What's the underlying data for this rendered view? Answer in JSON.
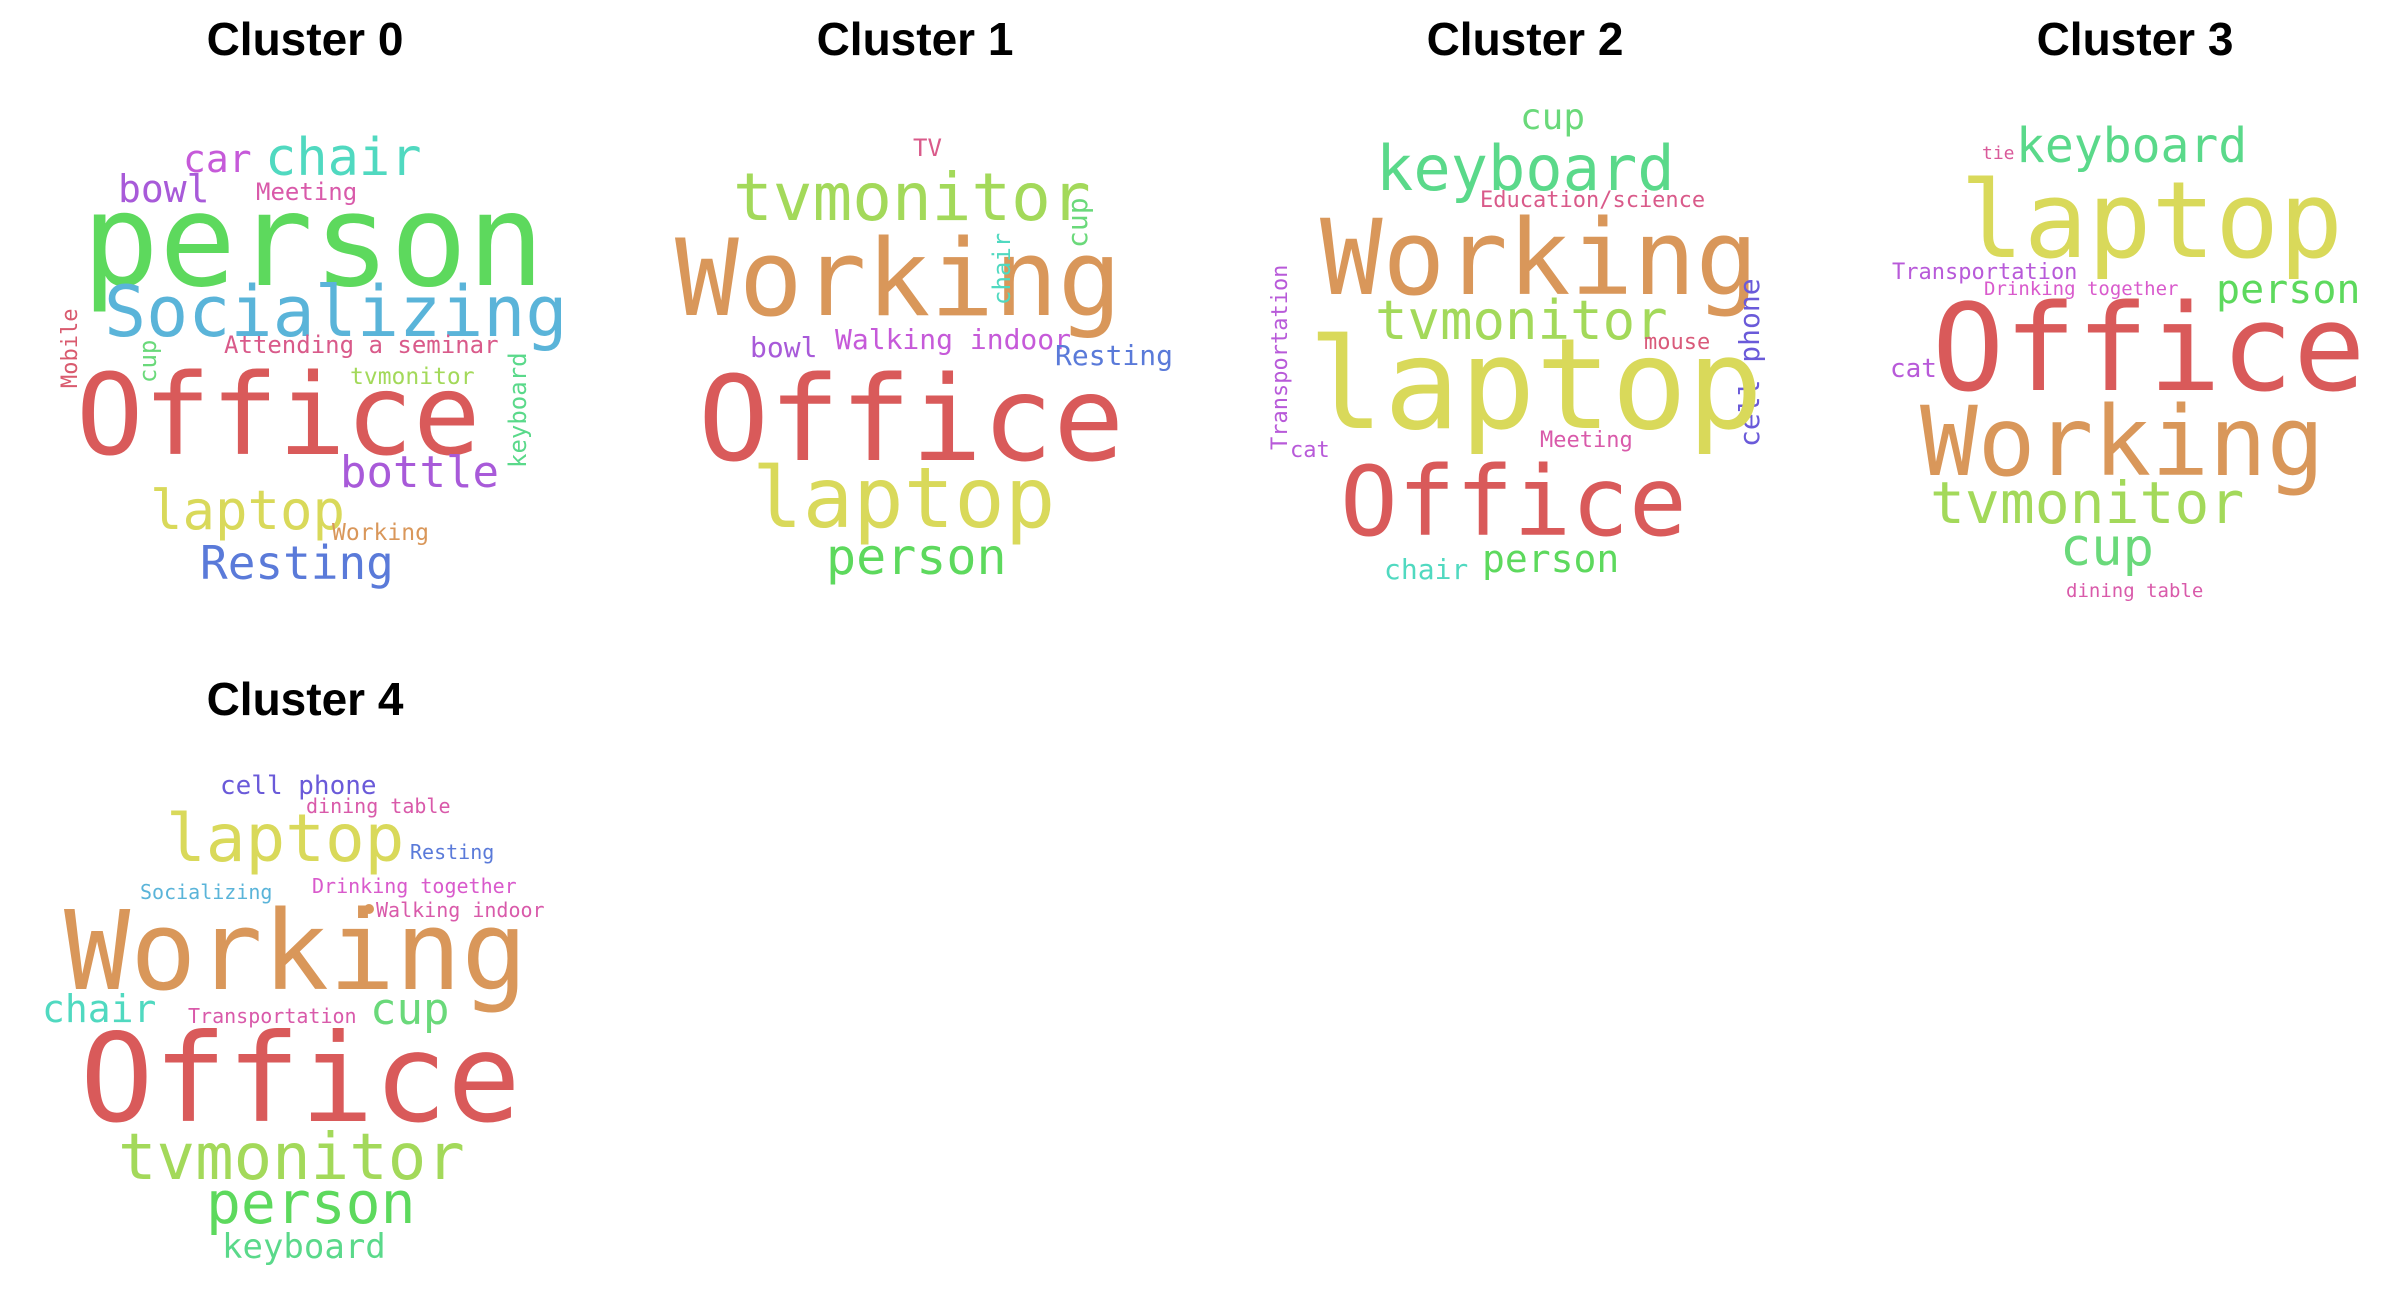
{
  "clusters": [
    {
      "title": "Cluster 0",
      "words": [
        {
          "text": "person",
          "color": "#5dd95d"
        },
        {
          "text": "Socializing",
          "color": "#5ab4d9"
        },
        {
          "text": "Office",
          "color": "#d95a5a"
        },
        {
          "text": "chair",
          "color": "#50d9c0"
        },
        {
          "text": "car",
          "color": "#c65ad9"
        },
        {
          "text": "bowl",
          "color": "#a85ad9"
        },
        {
          "text": "Meeting",
          "color": "#d95aaa"
        },
        {
          "text": "Attending a seminar",
          "color": "#d95a8a"
        },
        {
          "text": "tvmonitor",
          "color": "#a3d95a"
        },
        {
          "text": "cup",
          "color": "#6ad97a"
        },
        {
          "text": "Mobile",
          "color": "#d95a6e"
        },
        {
          "text": "keyboard",
          "color": "#5ad98a"
        },
        {
          "text": "bottle",
          "color": "#a85ad9"
        },
        {
          "text": "laptop",
          "color": "#d9d95a"
        },
        {
          "text": "Working",
          "color": "#d9975a"
        },
        {
          "text": "Resting",
          "color": "#5a7ad9"
        }
      ]
    },
    {
      "title": "Cluster 1",
      "words": [
        {
          "text": "TV",
          "color": "#d95a8a"
        },
        {
          "text": "tvmonitor",
          "color": "#a3d95a"
        },
        {
          "text": "Working",
          "color": "#d9975a"
        },
        {
          "text": "chair",
          "color": "#50d9c0"
        },
        {
          "text": "cup",
          "color": "#6ad97a"
        },
        {
          "text": "bowl",
          "color": "#a85ad9"
        },
        {
          "text": "Walking indoor",
          "color": "#c65ad9"
        },
        {
          "text": "Resting",
          "color": "#5a7ad9"
        },
        {
          "text": "Office",
          "color": "#d95a5a"
        },
        {
          "text": "laptop",
          "color": "#d9d95a"
        },
        {
          "text": "person",
          "color": "#5dd95d"
        }
      ]
    },
    {
      "title": "Cluster 2",
      "words": [
        {
          "text": "cup",
          "color": "#6ad97a"
        },
        {
          "text": "keyboard",
          "color": "#5ad98a"
        },
        {
          "text": "Education/science",
          "color": "#d95a8a"
        },
        {
          "text": "Working",
          "color": "#d9975a"
        },
        {
          "text": "tvmonitor",
          "color": "#a3d95a"
        },
        {
          "text": "mouse",
          "color": "#d95a7a"
        },
        {
          "text": "Transportation",
          "color": "#b85ad9"
        },
        {
          "text": "cell phone",
          "color": "#6a5ad9"
        },
        {
          "text": "laptop",
          "color": "#d9d95a"
        },
        {
          "text": "cat",
          "color": "#b85ad9"
        },
        {
          "text": "Meeting",
          "color": "#d95aaa"
        },
        {
          "text": "Office",
          "color": "#d95a5a"
        },
        {
          "text": "chair",
          "color": "#50d9c0"
        },
        {
          "text": "person",
          "color": "#5dd95d"
        }
      ]
    },
    {
      "title": "Cluster 3",
      "words": [
        {
          "text": "tie",
          "color": "#d95a9a"
        },
        {
          "text": "keyboard",
          "color": "#5ad98a"
        },
        {
          "text": "laptop",
          "color": "#d9d95a"
        },
        {
          "text": "Transportation",
          "color": "#b85ad9"
        },
        {
          "text": "Drinking together",
          "color": "#d95acc"
        },
        {
          "text": "person",
          "color": "#5dd95d"
        },
        {
          "text": "cat",
          "color": "#b85ad9"
        },
        {
          "text": "Office",
          "color": "#d95a5a"
        },
        {
          "text": "Working",
          "color": "#d9975a"
        },
        {
          "text": "tvmonitor",
          "color": "#a3d95a"
        },
        {
          "text": "cup",
          "color": "#6ad97a"
        },
        {
          "text": "dining table",
          "color": "#d95aaa"
        }
      ]
    },
    {
      "title": "Cluster 4",
      "words": [
        {
          "text": "cell phone",
          "color": "#6a5ad9"
        },
        {
          "text": "dining table",
          "color": "#d95aaa"
        },
        {
          "text": "laptop",
          "color": "#d9d95a"
        },
        {
          "text": "Resting",
          "color": "#5a7ad9"
        },
        {
          "text": "Socializing",
          "color": "#5ab4d9"
        },
        {
          "text": "Drinking together",
          "color": "#d95acc"
        },
        {
          "text": "Walking indoor",
          "color": "#d95aaa"
        },
        {
          "text": "Working",
          "color": "#d9975a"
        },
        {
          "text": "chair",
          "color": "#50d9c0"
        },
        {
          "text": "Transportation",
          "color": "#d95aaa"
        },
        {
          "text": "cup",
          "color": "#6ad97a"
        },
        {
          "text": "Office",
          "color": "#d95a5a"
        },
        {
          "text": "tvmonitor",
          "color": "#a3d95a"
        },
        {
          "text": "person",
          "color": "#5dd95d"
        },
        {
          "text": "keyboard",
          "color": "#5ad98a"
        }
      ]
    }
  ]
}
